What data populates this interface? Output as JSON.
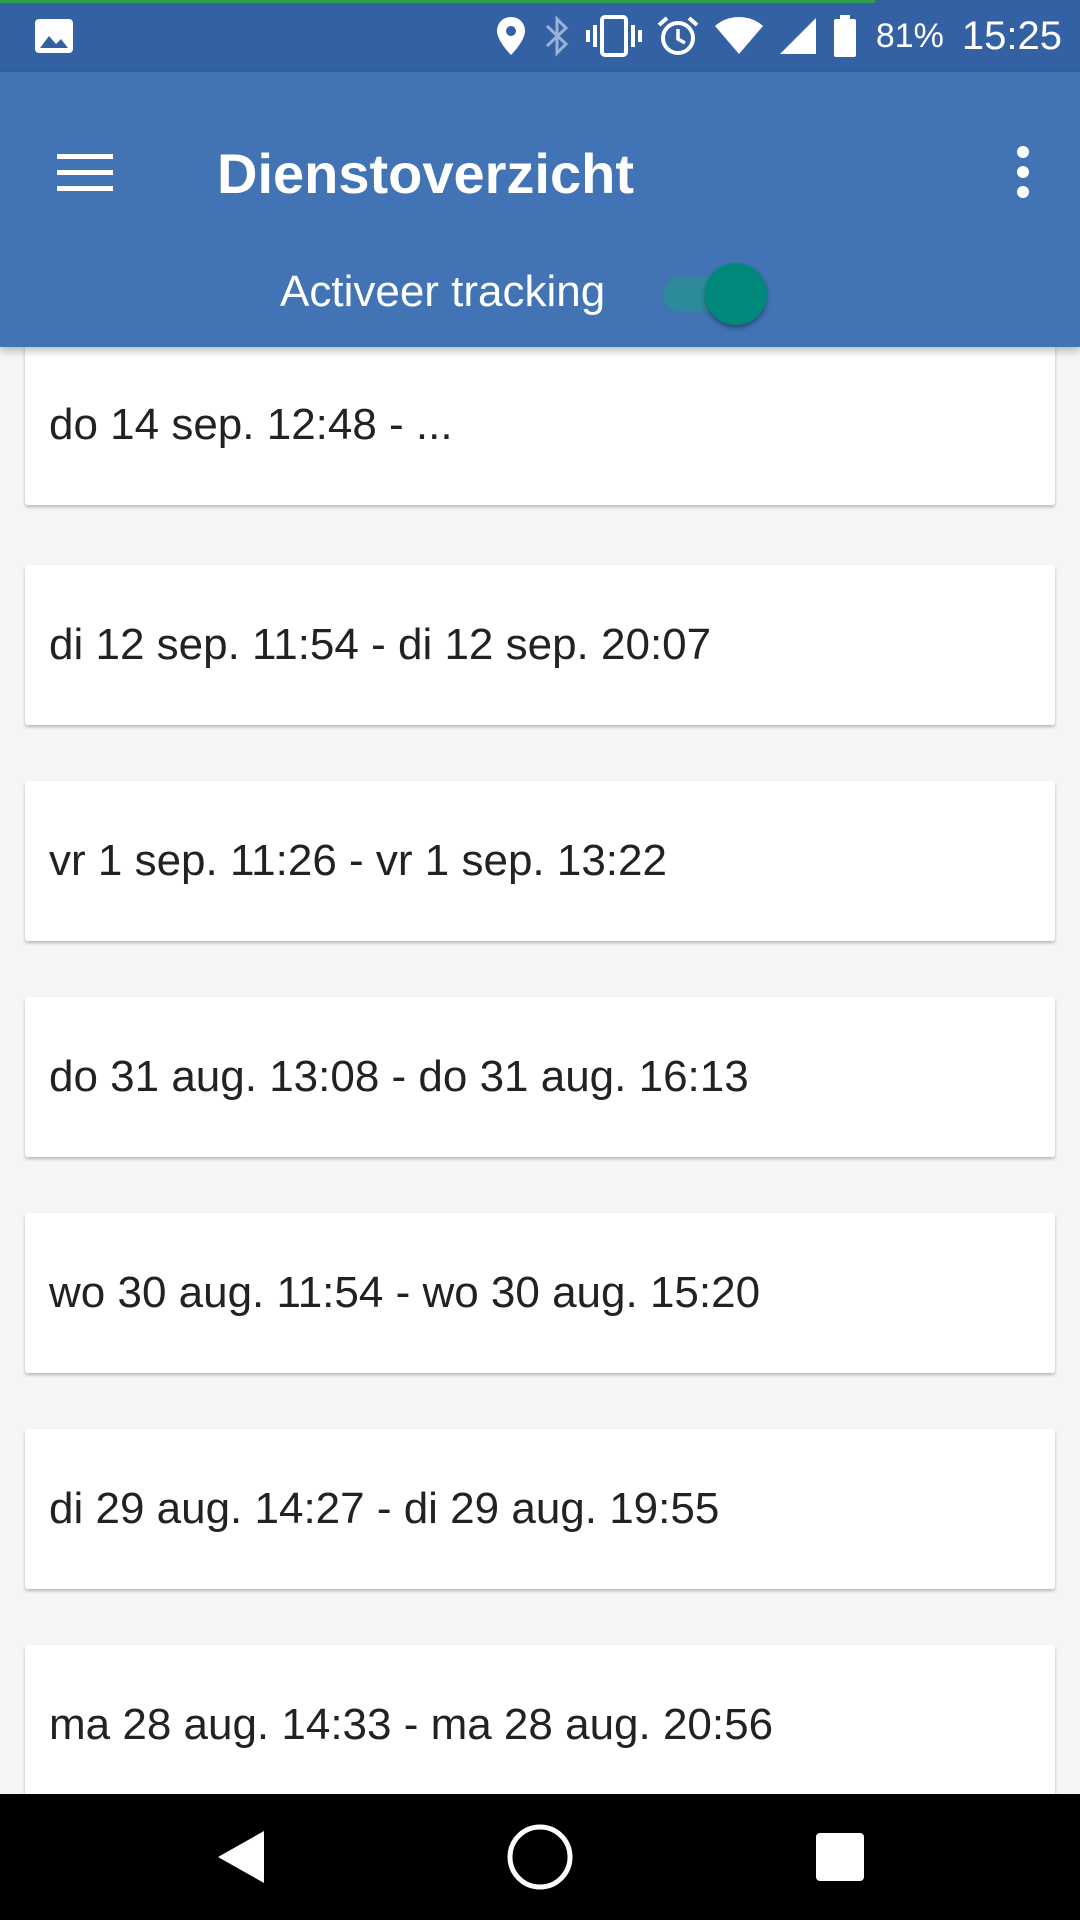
{
  "status_bar": {
    "battery_percent": "81%",
    "time": "15:25",
    "icons": [
      "image-icon",
      "location-icon",
      "bluetooth-icon",
      "vibrate-icon",
      "alarm-icon",
      "wifi-icon",
      "signal-icon",
      "battery-icon"
    ]
  },
  "app_bar": {
    "title": "Dienstoverzicht",
    "tracking_label": "Activeer tracking",
    "tracking_enabled": true,
    "primary_color": "#4173b5",
    "accent_color": "#00897b"
  },
  "shifts": [
    "do 14 sep. 12:48 - ...",
    "di 12 sep. 11:54 - di 12 sep. 20:07",
    "vr 1 sep. 11:26 - vr 1 sep. 13:22",
    "do 31 aug. 13:08 - do 31 aug. 16:13",
    "wo 30 aug. 11:54 - wo 30 aug. 15:20",
    "di 29 aug. 14:27 - di 29 aug. 19:55",
    "ma 28 aug. 14:33 - ma 28 aug. 20:56"
  ],
  "nav_bar": {
    "buttons": [
      "back-icon",
      "home-icon",
      "recents-icon"
    ]
  }
}
